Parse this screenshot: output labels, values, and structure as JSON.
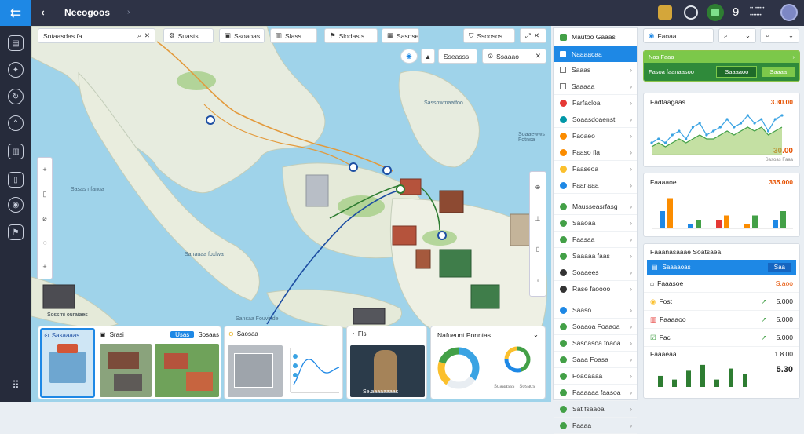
{
  "app": {
    "title": "Neeogoos"
  },
  "topbar": {
    "count": "9",
    "status_line1": "•• ••••••",
    "status_line2": "•••••••"
  },
  "search": {
    "value": "Sotaasdas fa"
  },
  "map_filters": [
    "Suasts",
    "Ssoaoas",
    "Slass",
    "Slodasts",
    "Sasose"
  ],
  "map_actions": {
    "layers": "Ssoosos",
    "share": "Sseasss",
    "view": "Ssaaao"
  },
  "map_labels": [
    "Sasas nfanua",
    "Sanauaa foxlwa",
    "Sassowmaatfoo",
    "Soaaewws Fotnsa",
    "Sossmi ouraiaes",
    "Sansaa Fouvinde"
  ],
  "bottom_cards": {
    "card1": {
      "title": "Sasaaaas"
    },
    "card2": {
      "title": "Srasi",
      "badge": "Usas",
      "tag": "Sosaas"
    },
    "card3": {
      "title": "Saosaa"
    },
    "card4": {
      "title": "Fls",
      "caption": "Se.aaaaaaaas"
    },
    "card5": {
      "title": "Nafueunt Ponntas",
      "legend": [
        "Suaaasss",
        "Sosaos"
      ]
    }
  },
  "list_panel": {
    "header": "Mautoo Gaaas",
    "selected": "Naaaacaa",
    "items": [
      {
        "label": "Saaas",
        "color": "#ffffff",
        "kind": "square"
      },
      {
        "label": "Saaaaa",
        "color": "#ffffff",
        "kind": "square"
      },
      {
        "label": "Farfacloa",
        "color": "#e53935",
        "kind": "dot"
      },
      {
        "label": "Soaasdoaenst",
        "color": "#0097a7",
        "kind": "dot"
      },
      {
        "label": "Faoaeo",
        "color": "#fb8c00",
        "kind": "dot"
      },
      {
        "label": "Faaso fla",
        "color": "#fb8c00",
        "kind": "dot"
      },
      {
        "label": "Faaseoa",
        "color": "#fbc02d",
        "kind": "dot"
      },
      {
        "label": "Faarlaaa",
        "color": "#1e88e5",
        "kind": "dot"
      }
    ],
    "group2": [
      {
        "label": "Mausseasrfasg",
        "color": "#43a047"
      },
      {
        "label": "Saaoaa",
        "color": "#43a047"
      },
      {
        "label": "Faasaa",
        "color": "#43a047"
      },
      {
        "label": "Saaaaa faas",
        "color": "#43a047"
      },
      {
        "label": "Soaaees",
        "color": "#333333"
      },
      {
        "label": "Rase faoooo",
        "color": "#333333"
      }
    ],
    "group3": [
      {
        "label": "Saaso",
        "color": "#1e88e5"
      },
      {
        "label": "Soaaoa Foaaoa",
        "color": "#43a047"
      },
      {
        "label": "Sasoasoa foaoa",
        "color": "#43a047"
      },
      {
        "label": "Saaa Foasa",
        "color": "#43a047"
      },
      {
        "label": "Foaoaaaa",
        "color": "#43a047"
      },
      {
        "label": "Faaaaaa faasoa",
        "color": "#43a047"
      },
      {
        "label": "Sat fsaaoa",
        "color": "#43a047"
      },
      {
        "label": "Faaaa",
        "color": "#43a047"
      }
    ]
  },
  "right": {
    "header_chip": "Faoaa",
    "green_bar": {
      "title": "Nas Faaa",
      "row": "Fasoa faanaasoo",
      "btn1": "Saaaaoo",
      "btn2": "Saaaa"
    },
    "line_card": {
      "title": "Fadfaagaas",
      "value_top": "3.30.00",
      "value_bottom": "30.00",
      "sub": "Sasoas Faaa"
    },
    "bar_card": {
      "title": "Faaaaoe",
      "value": "335.000"
    },
    "list_card": {
      "title": "Faaanasaaae Soatsaea",
      "header": "Saaaaoas",
      "header_tag": "Saa",
      "rows": [
        {
          "label": "Faaasoe",
          "value": "S.aoo"
        },
        {
          "label": "Fost",
          "value": "5.000"
        },
        {
          "label": "Faaaaoo",
          "value": "5.000"
        },
        {
          "label": "Fac",
          "value": "5.000"
        }
      ],
      "footer_label": "Faaaeaa",
      "footer_value_top": "1.8.00",
      "footer_value_bottom": "5.30"
    }
  },
  "line_chart": {
    "series": [
      {
        "values": [
          3,
          4,
          3,
          5,
          6,
          4,
          7,
          8,
          5,
          6,
          7,
          9,
          7,
          8,
          10,
          8,
          9,
          6,
          9,
          10
        ],
        "color": "#3aa3e3"
      },
      {
        "values": [
          2,
          3,
          2,
          3,
          4,
          3,
          4,
          5,
          4,
          4,
          5,
          6,
          5,
          6,
          7,
          6,
          7,
          5,
          6,
          7
        ],
        "color": "#43a047"
      }
    ]
  },
  "bar_chart": {
    "groups": [
      {
        "values": [
          4,
          7
        ],
        "colors": [
          "#1e88e5",
          "#fb8c00"
        ]
      },
      {
        "values": [
          1,
          2
        ],
        "colors": [
          "#1e88e5",
          "#43a047"
        ]
      },
      {
        "values": [
          2,
          3
        ],
        "colors": [
          "#e53935",
          "#fb8c00"
        ]
      },
      {
        "values": [
          1,
          3
        ],
        "colors": [
          "#fb8c00",
          "#43a047"
        ]
      },
      {
        "values": [
          2,
          4
        ],
        "colors": [
          "#1e88e5",
          "#43a047"
        ]
      }
    ]
  },
  "small_bars": {
    "values": [
      1.5,
      1,
      2.2,
      3,
      1,
      2.5,
      1.8
    ]
  },
  "donut1": {
    "values": [
      35,
      25,
      20,
      20
    ],
    "colors": [
      "#3aa3e3",
      "#e8edf2",
      "#fbc02d",
      "#43a047"
    ]
  },
  "donut2": {
    "values": [
      45,
      30,
      25
    ],
    "colors": [
      "#43a047",
      "#1e88e5",
      "#fbc02d"
    ]
  },
  "colors": {
    "accent": "#1e88e5",
    "green": "#4caf50",
    "dark": "#2e3346"
  }
}
